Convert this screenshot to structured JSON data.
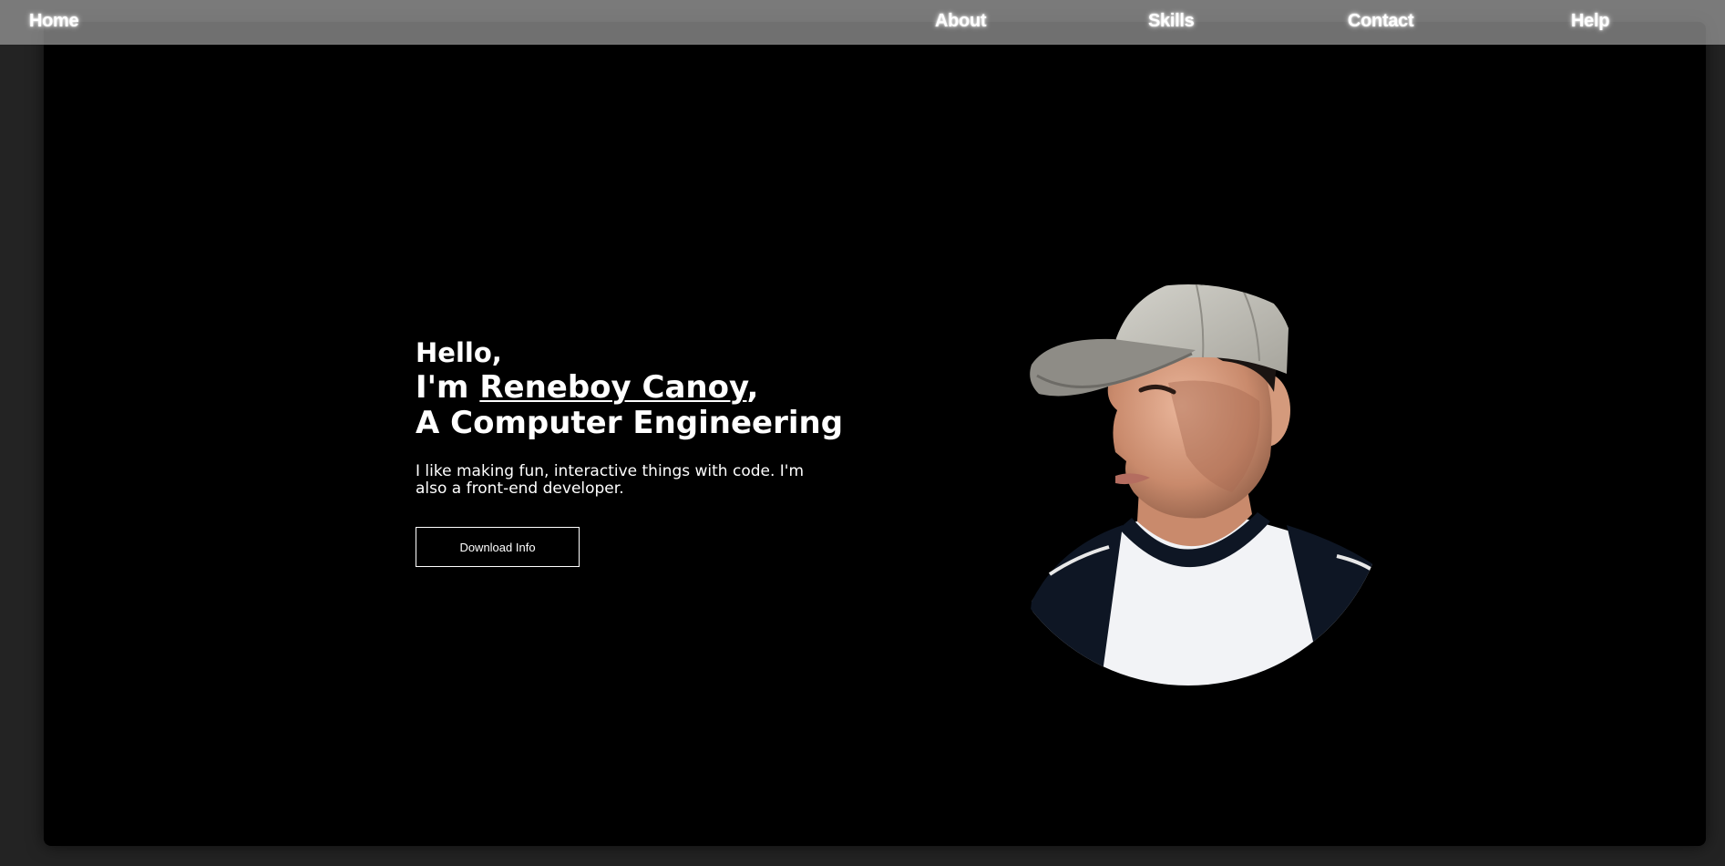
{
  "nav": {
    "home": "Home",
    "about": "About",
    "skills": "Skills",
    "contact": "Contact",
    "help": "Help"
  },
  "hero": {
    "greeting": "Hello,",
    "intro_prefix": "I'm ",
    "name": "Reneboy Canoy",
    "intro_suffix": ",",
    "role": "A Computer Engineering",
    "tagline": "I like making fun, interactive things with code. I'm also a front-end developer.",
    "download_label": "Download Info"
  },
  "colors": {
    "background": "#232323",
    "hero_background": "#000000",
    "navbar": "#a0a0a0",
    "text": "#ffffff"
  },
  "icons": {
    "profile_photo": "portrait-photo"
  }
}
